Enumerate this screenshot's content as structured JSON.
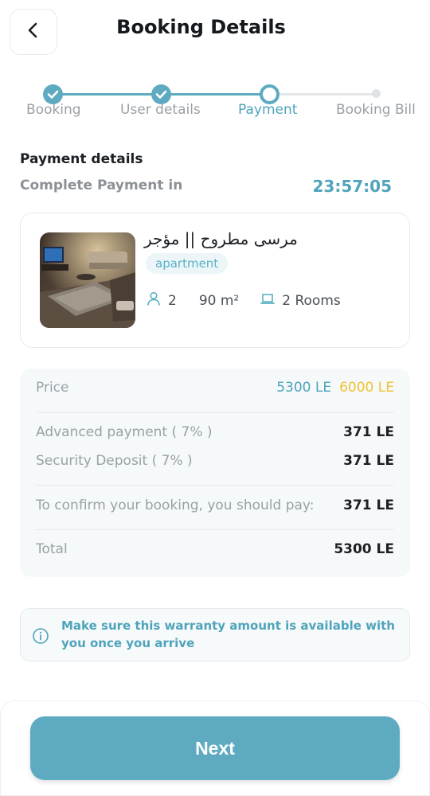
{
  "header": {
    "title": "Booking Details",
    "back_icon": "chevron-left-icon"
  },
  "stepper": {
    "steps": [
      {
        "label": "Booking",
        "state": "done"
      },
      {
        "label": "User details",
        "state": "done"
      },
      {
        "label": "Payment",
        "state": "current"
      },
      {
        "label": "Booking Bill",
        "state": "pending"
      }
    ]
  },
  "payment": {
    "section_title": "Payment details",
    "complete_label": "Complete Payment in",
    "timer": "23:57:05"
  },
  "property": {
    "name": "مرسى مطروح || مؤجر",
    "type": "apartment",
    "guests": "2",
    "area": "90 m²",
    "rooms": "2 Rooms"
  },
  "pricing": {
    "price_label": "Price",
    "price_new": "5300 LE",
    "price_old": "6000 LE",
    "advanced_label": "Advanced payment ( 7% )",
    "advanced_value": "371 LE",
    "deposit_label": "Security Deposit ( 7% )",
    "deposit_value": "371 LE",
    "confirm_label": "To confirm your booking, you should pay:",
    "confirm_value": "371 LE",
    "total_label": "Total",
    "total_value": "5300 LE"
  },
  "notice": {
    "text": "Make sure this warranty amount is available with you once you arrive"
  },
  "footer": {
    "next_label": "Next"
  },
  "colors": {
    "accent": "#5eabc1",
    "accent_text": "#4fa3bb",
    "old_price": "#f0c232"
  }
}
